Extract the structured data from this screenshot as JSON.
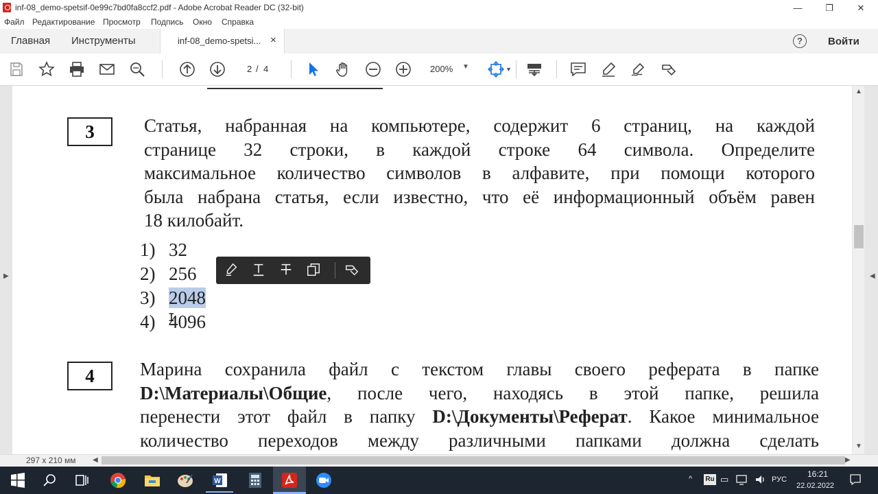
{
  "window": {
    "title": "inf-08_demo-spetsif-0e99c7bd0fa8ccf2.pdf - Adobe Acrobat Reader DC (32-bit)",
    "controls": {
      "minimize": "—",
      "restore": "❐",
      "close": "✕"
    }
  },
  "menu": {
    "items": [
      "Файл",
      "Редактирование",
      "Просмотр",
      "Подпись",
      "Окно",
      "Справка"
    ]
  },
  "tabs": {
    "home": "Главная",
    "tools": "Инструменты",
    "document": "inf-08_demo-spetsi...",
    "close": "×",
    "signin": "Войти",
    "help": "?"
  },
  "toolbar": {
    "page_current": "2",
    "page_sep": "/",
    "page_total": "4",
    "zoom": "200%",
    "icons": [
      "save-icon",
      "bookmark-star-icon",
      "print-icon",
      "email-icon",
      "find-icon",
      "page-up-icon",
      "page-down-icon",
      "select-cursor-icon",
      "hand-icon",
      "zoom-out-icon",
      "zoom-in-icon",
      "fit-page-icon",
      "scroll-mode-icon",
      "comment-icon",
      "highlight-pen-icon",
      "sign-icon",
      "more-tools-icon"
    ]
  },
  "document": {
    "q3": {
      "number": "3",
      "lines": [
        "Статья, набранная на компьютере, содержит 6 страниц, на каждой",
        "странице 32 строки, в каждой строке 64 символа. Определите",
        "максимальное количество символов в алфавите, при помощи которого",
        "была набрана статья, если известно, что её информационный объём равен",
        "18 килобайт."
      ],
      "answers": [
        {
          "n": "1)",
          "v": "32"
        },
        {
          "n": "2)",
          "v": "256"
        },
        {
          "n": "3)",
          "v": "2048"
        },
        {
          "n": "4)",
          "v": "4096"
        }
      ],
      "selected_answer_index": 2
    },
    "q4": {
      "number": "4",
      "l1": "Марина сохранила файл с текстом главы своего реферата в папке",
      "l2a": "D:\\Материалы\\Общие",
      "l2b": ", после чего, находясь в этой папке, решила",
      "l3a": "перенести этот файл в папку ",
      "l3b": "D:\\Документы\\Реферат",
      "l3c": ". Какое минимальное",
      "l4": "количество переходов между различными папками должна сделать"
    },
    "popup_tools": [
      "highlight-icon",
      "underline-text-icon",
      "strikethrough-icon",
      "copy-icon",
      "more-icon"
    ]
  },
  "status": {
    "page_size": "297 x 210 мм"
  },
  "taskbar": {
    "apps": [
      "search-icon",
      "task-view-icon",
      "chrome-icon",
      "file-explorer-icon",
      "paint-icon",
      "word-icon",
      "calculator-icon",
      "acrobat-icon",
      "zoom-app-icon"
    ],
    "lang": "РУС",
    "time": "16:21",
    "date": "22.02.2022",
    "ime": "Ru"
  },
  "colors": {
    "selection": "#b9cdea",
    "acrobat_red": "#d5261c",
    "taskbar": "#1c2530"
  }
}
